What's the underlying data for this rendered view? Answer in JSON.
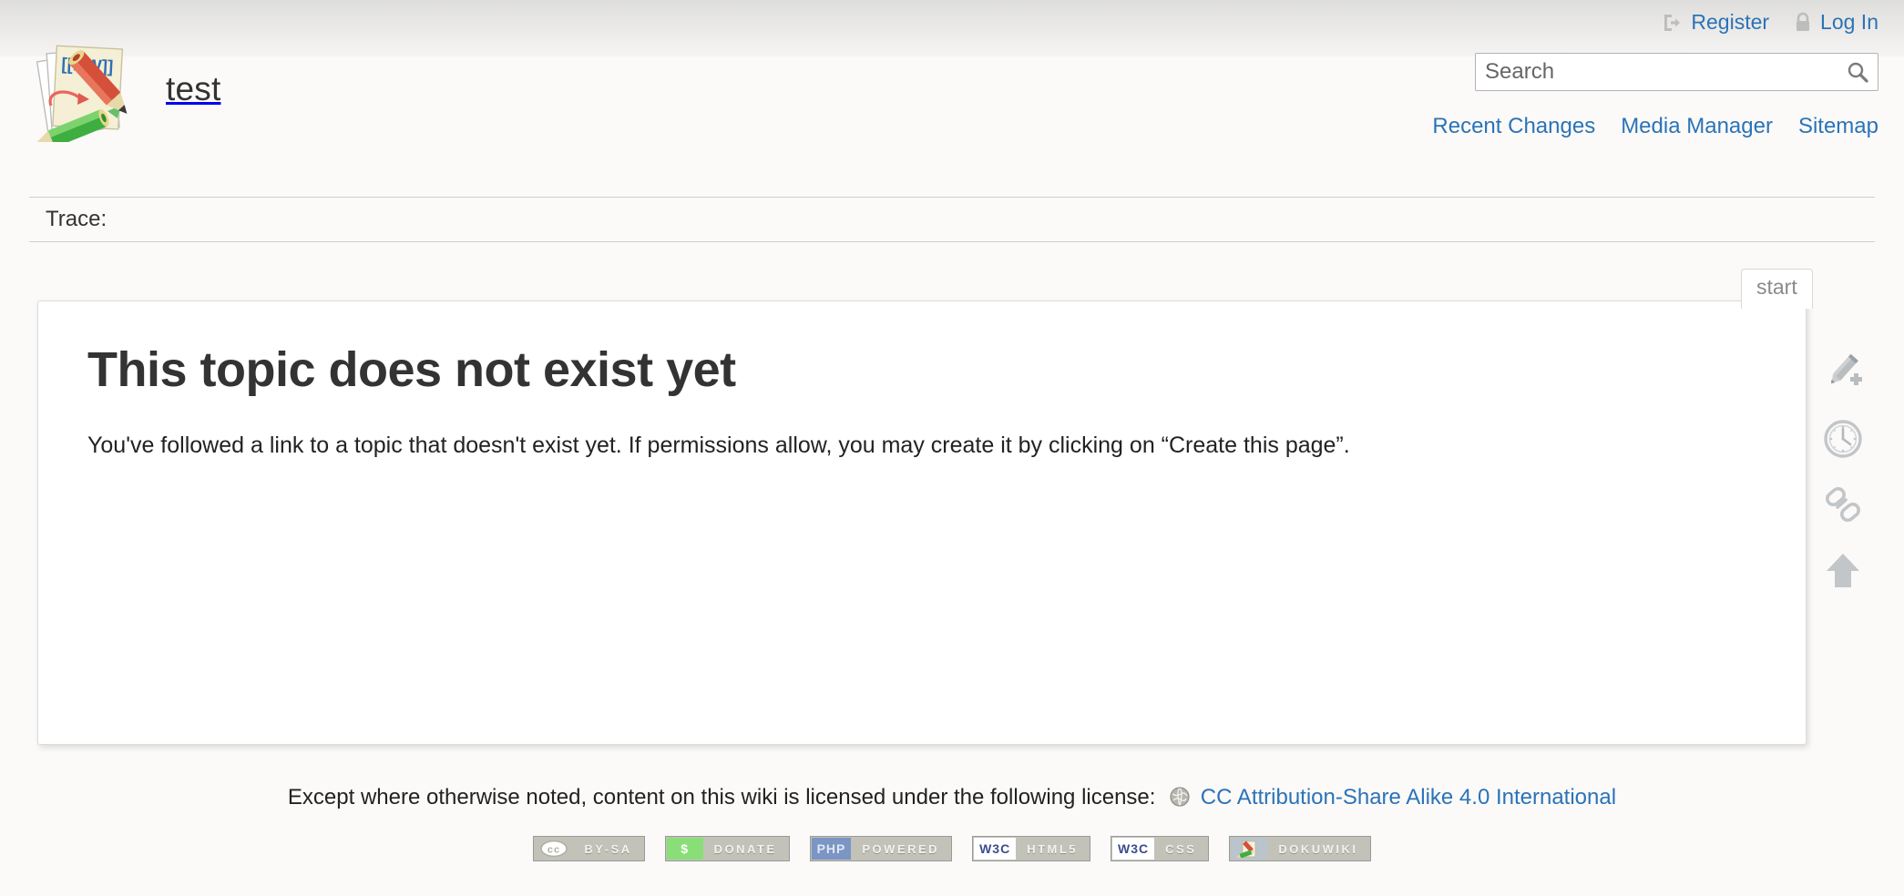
{
  "header": {
    "site_title": "test",
    "logo_icon": "dokuwiki-logo",
    "logo_paper_text": "[[DW]]",
    "user_tools": [
      {
        "label": "Register",
        "icon": "register-door-icon"
      },
      {
        "label": "Log In",
        "icon": "lock-icon"
      }
    ],
    "search": {
      "placeholder": "Search",
      "value": "",
      "button_icon": "search-icon"
    },
    "site_tools": [
      {
        "label": "Recent Changes"
      },
      {
        "label": "Media Manager"
      },
      {
        "label": "Sitemap"
      }
    ]
  },
  "breadcrumb": {
    "label": "Trace:",
    "items": []
  },
  "page_tab": {
    "label": "start"
  },
  "content": {
    "heading": "This topic does not exist yet",
    "paragraph": "You've followed a link to a topic that doesn't exist yet. If permissions allow, you may create it by clicking on “Create this page”."
  },
  "page_tools": [
    {
      "name": "create-page",
      "icon": "pencil-plus-icon"
    },
    {
      "name": "old-revisions",
      "icon": "clock-icon"
    },
    {
      "name": "backlinks",
      "icon": "chain-link-icon"
    },
    {
      "name": "back-to-top",
      "icon": "arrow-up-icon"
    }
  ],
  "footer": {
    "license_prefix": "Except where otherwise noted, content on this wiki is licensed under the following license:",
    "license_icon": "globe-icon",
    "license_link": "CC Attribution-Share Alike 4.0 International",
    "badges": [
      {
        "left": "(cc)",
        "right": "BY-SA",
        "style": "b-cc"
      },
      {
        "left": "$",
        "right": "DONATE",
        "style": "b-donate"
      },
      {
        "left": "PHP",
        "right": "POWERED",
        "style": "b-php"
      },
      {
        "left": "W3C",
        "right": "HTML5",
        "style": "b-w3c"
      },
      {
        "left": "W3C",
        "right": "CSS",
        "style": "b-w3c"
      },
      {
        "left": "",
        "right": "DOKUWIKI",
        "style": "b-dw"
      }
    ]
  },
  "colors": {
    "link": "#2b73b7",
    "page_bg": "#fbfaf9",
    "content_bg": "#ffffff",
    "heading": "#333333",
    "tab_text": "#8a8a8a",
    "donate_green": "#8ade78",
    "php_blue": "#7b95c4"
  }
}
